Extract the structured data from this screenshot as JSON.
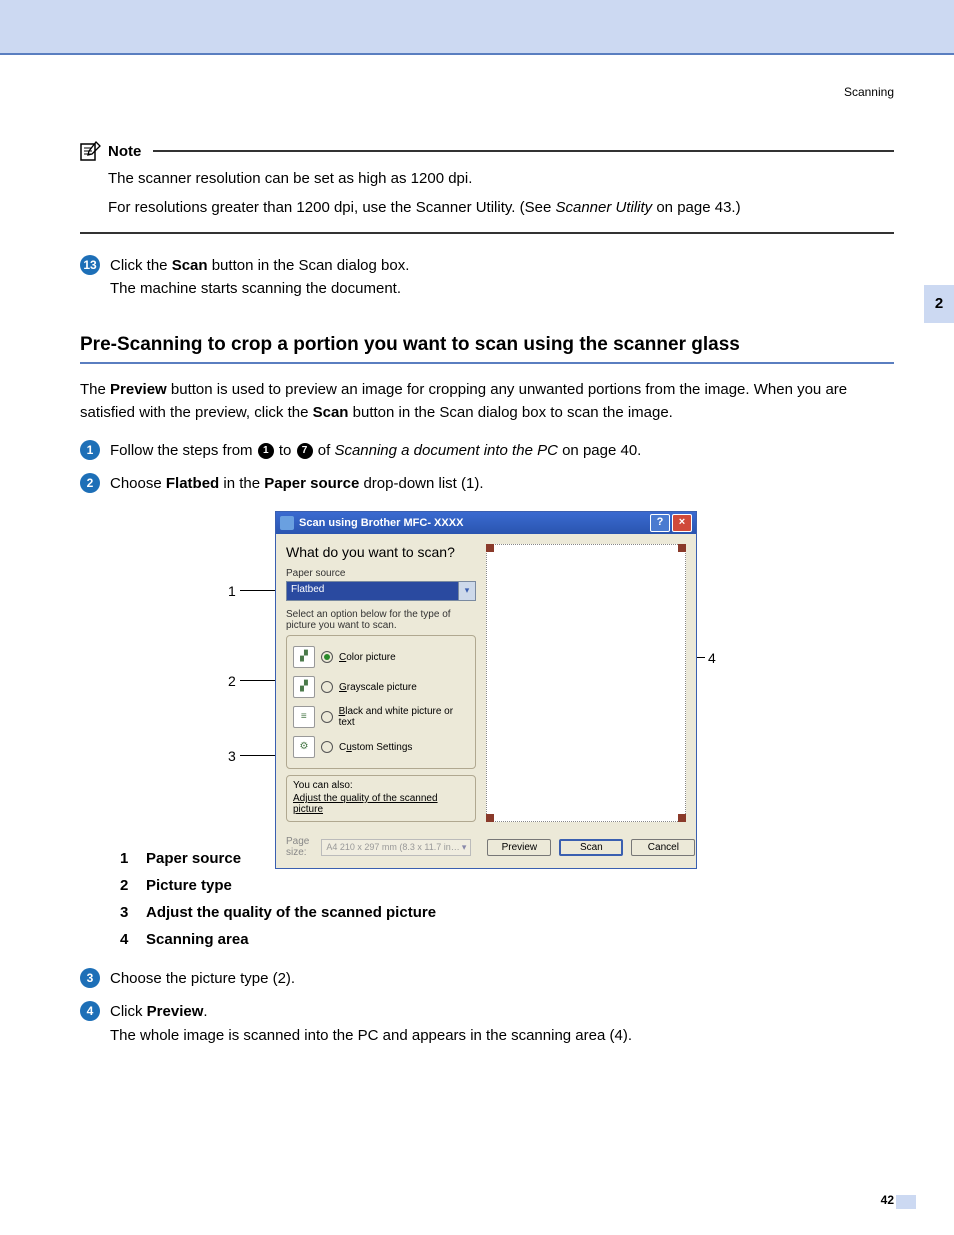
{
  "header": {
    "running": "Scanning"
  },
  "side_tab": "2",
  "note": {
    "title": "Note",
    "line1": "The scanner resolution can be set as high as 1200 dpi.",
    "line2_a": "For resolutions greater than 1200 dpi, use the Scanner Utility. (See ",
    "line2_link": "Scanner Utility",
    "line2_b": " on page 43.)"
  },
  "step13": {
    "num": "13",
    "text_a": "Click the ",
    "scan": "Scan",
    "text_b": " button in the Scan dialog box.",
    "text_c": "The machine starts scanning the document."
  },
  "section_title": "Pre-Scanning to crop a portion you want to scan using the scanner glass",
  "intro": {
    "a": "The ",
    "preview": "Preview",
    "b": " button is used to preview an image for cropping any unwanted portions from the image. When you are satisfied with the preview, click the ",
    "scan": "Scan",
    "c": " button in the Scan dialog box to scan the image."
  },
  "steps": {
    "s1": {
      "num": "1",
      "a": "Follow the steps from ",
      "d1": "1",
      "mid": " to ",
      "d7": "7",
      "b": " of ",
      "ital": "Scanning a document into the PC",
      "c": " on page 40."
    },
    "s2": {
      "num": "2",
      "a": "Choose ",
      "flatbed": "Flatbed",
      "b": " in the ",
      "paper": "Paper source",
      "c": " drop-down list (1)."
    },
    "s3": {
      "num": "3",
      "text": "Choose the picture type (2)."
    },
    "s4": {
      "num": "4",
      "a": "Click ",
      "preview": "Preview",
      "b": ".",
      "c": "The whole image is scanned into the PC and appears in the scanning area (4)."
    }
  },
  "dialog": {
    "title": "Scan using Brother MFC- XXXX",
    "prompt": "What do you want to scan?",
    "paper_label": "Paper source",
    "paper_value": "Flatbed",
    "select_help": "Select an option below for the type of picture you want to scan.",
    "opt_color": "Color picture",
    "opt_gray": "Grayscale picture",
    "opt_bw": "Black and white picture or text",
    "opt_custom": "Custom Settings",
    "also": "You can also:",
    "also_link": "Adjust the quality of the scanned picture",
    "page_size_label": "Page size:",
    "page_size_value": "A4 210 x 297 mm (8.3 x 11.7 in…",
    "btn_preview": "Preview",
    "btn_scan": "Scan",
    "btn_cancel": "Cancel"
  },
  "callouts": {
    "c1": "1",
    "c2": "2",
    "c3": "3",
    "c4": "4"
  },
  "legend": {
    "i1": {
      "n": "1",
      "t": "Paper source"
    },
    "i2": {
      "n": "2",
      "t": "Picture type"
    },
    "i3": {
      "n": "3",
      "t": "Adjust the quality of the scanned picture"
    },
    "i4": {
      "n": "4",
      "t": "Scanning area"
    }
  },
  "page_number": "42"
}
